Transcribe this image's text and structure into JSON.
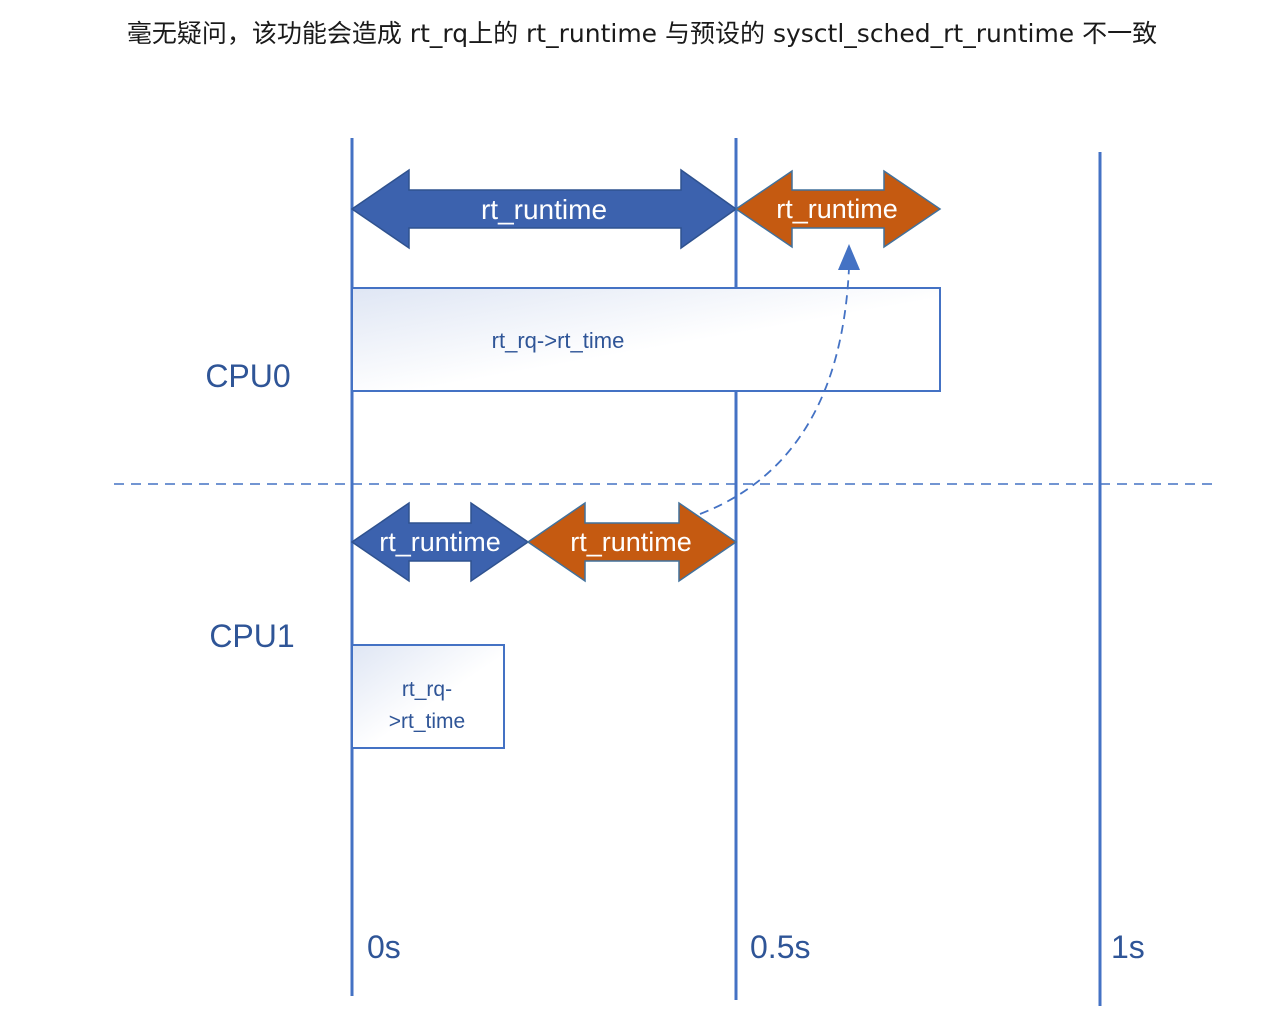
{
  "caption": "毫无疑问，该功能会造成 rt_rq上的 rt_runtime 与预设的 sysctl_sched_rt_runtime 不一致",
  "colors": {
    "line_blue": "#4472C4",
    "arrow_blue": "#3C62AE",
    "arrow_orange": "#C55A11",
    "text_blue": "#2F5597"
  },
  "cpu0": {
    "label": "CPU0",
    "arrow_left_label": "rt_runtime",
    "arrow_right_label": "rt_runtime",
    "box_label": "rt_rq->rt_time"
  },
  "cpu1": {
    "label": "CPU1",
    "arrow_left_label": "rt_runtime",
    "arrow_right_label": "rt_runtime",
    "box_label_line1": "rt_rq-",
    "box_label_line2": ">rt_time"
  },
  "timeline": {
    "tick_0": "0s",
    "tick_half": "0.5s",
    "tick_1": "1s"
  }
}
